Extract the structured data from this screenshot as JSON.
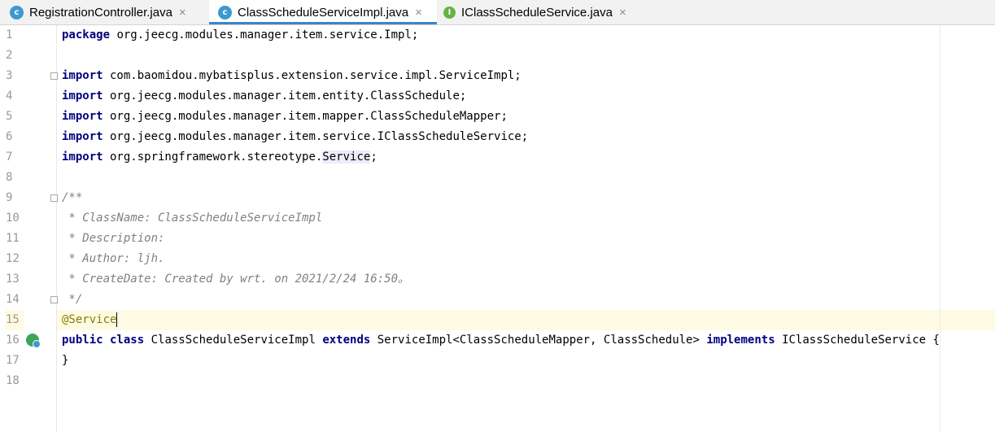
{
  "tabs": [
    {
      "label": "RegistrationController.java",
      "icon": "class-file-icon",
      "icon_letter": "c",
      "active": false
    },
    {
      "label": "ClassScheduleServiceImpl.java",
      "icon": "class-file-icon",
      "icon_letter": "c",
      "active": true
    },
    {
      "label": "IClassScheduleService.java",
      "icon": "interface-file-icon",
      "icon_letter": "I",
      "active": false
    }
  ],
  "tab_close_glyph": "×",
  "line_numbers": [
    "1",
    "2",
    "3",
    "4",
    "5",
    "6",
    "7",
    "8",
    "9",
    "10",
    "11",
    "12",
    "13",
    "14",
    "15",
    "16",
    "17",
    "18"
  ],
  "code": {
    "l1_kw": "package",
    "l1_text": " org.jeecg.modules.manager.item.service.Impl;",
    "l3_kw": "import",
    "l3_text": " com.baomidou.mybatisplus.extension.service.impl.ServiceImpl;",
    "l4_kw": "import",
    "l4_text": " org.jeecg.modules.manager.item.entity.ClassSchedule;",
    "l5_kw": "import",
    "l5_text": " org.jeecg.modules.manager.item.mapper.ClassScheduleMapper;",
    "l6_kw": "import",
    "l6_text": " org.jeecg.modules.manager.item.service.IClassScheduleService;",
    "l7_kw": "import",
    "l7_text": " org.springframework.stereotype.",
    "l7_usage": "Service",
    "l7_end": ";",
    "l9": "/**",
    "l10": " * ClassName: ClassScheduleServiceImpl",
    "l11": " * Description:",
    "l12": " * Author: ljh.",
    "l13": " * CreateDate: Created by wrt. on 2021/2/24 16:50。",
    "l14": " */",
    "l15": "@Service",
    "l16_kw1": "public class",
    "l16_name": " ClassScheduleServiceImpl ",
    "l16_kw2": "extends",
    "l16_mid": " ServiceImpl<ClassScheduleMapper, ClassSchedule> ",
    "l16_kw3": "implements",
    "l16_end": " IClassScheduleService {",
    "l17": "}"
  },
  "colors": {
    "keyword": "#000080",
    "comment": "#808080",
    "annotation": "#808000",
    "current_line": "#fffae3",
    "active_tab_underline": "#4083c9"
  }
}
